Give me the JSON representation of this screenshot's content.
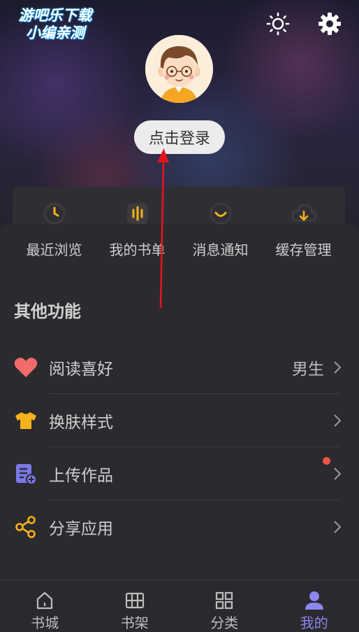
{
  "watermark": {
    "line1": "游吧乐下载",
    "line2": "小编亲测"
  },
  "header": {
    "sun_icon": "sun-icon",
    "gear_icon": "gear-icon",
    "avatar": "cartoon-boy-avatar",
    "login_label": "点击登录"
  },
  "quick_actions": [
    {
      "label": "最近浏览",
      "icon": "clock-history-icon"
    },
    {
      "label": "我的书单",
      "icon": "booklist-icon"
    },
    {
      "label": "消息通知",
      "icon": "message-smile-icon"
    },
    {
      "label": "缓存管理",
      "icon": "cloud-download-icon"
    }
  ],
  "section_title": "其他功能",
  "menu": [
    {
      "label": "阅读喜好",
      "value": "男生",
      "icon": "heart-icon",
      "color": "#f26b6b"
    },
    {
      "label": "换肤样式",
      "value": "",
      "icon": "tshirt-icon",
      "color": "#f5b21b"
    },
    {
      "label": "上传作品",
      "value": "",
      "icon": "upload-doc-icon",
      "color": "#7b77e6",
      "badge": true
    },
    {
      "label": "分享应用",
      "value": "",
      "icon": "share-icon",
      "color": "#f5b21b"
    }
  ],
  "tabs": [
    {
      "label": "书城",
      "icon": "home-icon",
      "active": false
    },
    {
      "label": "书架",
      "icon": "bookshelf-icon",
      "active": false
    },
    {
      "label": "分类",
      "icon": "grid-icon",
      "active": false
    },
    {
      "label": "我的",
      "icon": "user-icon",
      "active": true
    }
  ],
  "colors": {
    "accent": "#8c86f0",
    "icon_yellow": "#f5b21b",
    "badge_red": "#f05546",
    "arrow_red": "#e0161e"
  }
}
